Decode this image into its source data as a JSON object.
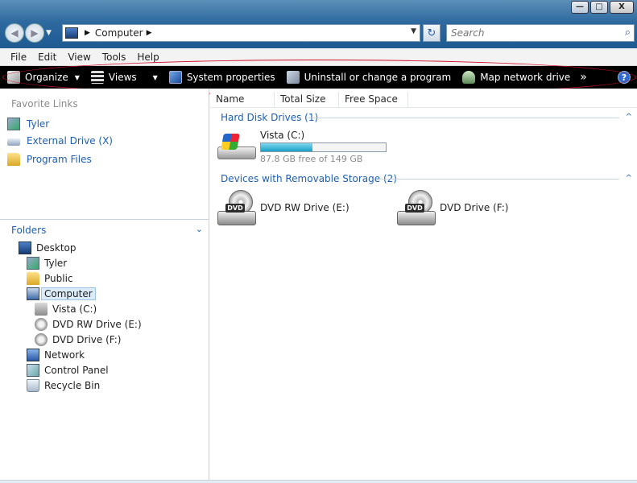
{
  "window": {
    "minimize_glyph": "—",
    "maximize_glyph": "□",
    "close_glyph": "X"
  },
  "navigation": {
    "back_glyph": "◀",
    "forward_glyph": "▶",
    "recent_glyph": "▼",
    "address": "Computer",
    "breadcrumb_sep": "▶",
    "address_dropdown": "▼",
    "refresh_glyph": "↻",
    "search_placeholder": "Search",
    "search_glyph": "⌕"
  },
  "menu": [
    "File",
    "Edit",
    "View",
    "Tools",
    "Help"
  ],
  "commands": {
    "organize": "Organize",
    "views": "Views",
    "system_properties": "System properties",
    "uninstall": "Uninstall or change a program",
    "map_drive": "Map network drive",
    "more": "»",
    "help": "?",
    "dropdown": "▼"
  },
  "favorites": {
    "title": "Favorite Links",
    "items": [
      "Tyler",
      "External Drive (X)",
      "Program Files"
    ]
  },
  "folders": {
    "title": "Folders",
    "chevron": "⌄",
    "tree": [
      "Desktop",
      "Tyler",
      "Public",
      "Computer",
      "Vista (C:)",
      "DVD RW Drive (E:)",
      "DVD Drive (F:)",
      "Network",
      "Control Panel",
      "Recycle Bin"
    ]
  },
  "columns": [
    "Name",
    "Total Size",
    "Free Space"
  ],
  "groups": {
    "hard_disks": "Hard Disk Drives (1)",
    "removable": "Devices with Removable Storage (2)",
    "collapse_glyph": "^"
  },
  "drives": {
    "vista": {
      "name": "Vista (C:)",
      "free_text": "87.8 GB free of 149 GB",
      "used_fraction": 0.41
    },
    "dvd_tag": "DVD",
    "dvd_rw": "DVD RW Drive (E:)",
    "dvd": "DVD Drive (F:)"
  },
  "colors": {
    "accent_link": "#1d5fb5",
    "command_bar": "#000000",
    "annotation_ellipse": "#d0102a",
    "usage_bar": "#1aa0c8"
  }
}
